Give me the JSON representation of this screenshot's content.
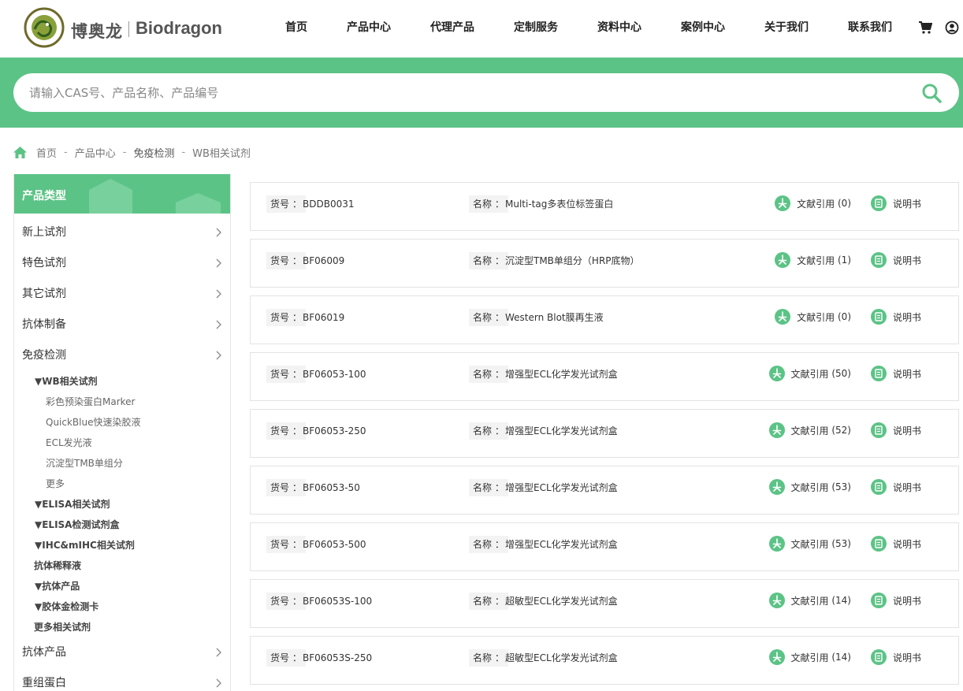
{
  "brand": {
    "name_cn": "博奥龙",
    "name_en": "Biodragon",
    "logo_icon": "biodragon-logo"
  },
  "nav": {
    "items": [
      "首页",
      "产品中心",
      "代理产品",
      "定制服务",
      "资料中心",
      "案例中心",
      "关于我们",
      "联系我们"
    ],
    "cart_icon": "cart-icon",
    "user_icon": "user-icon"
  },
  "search": {
    "placeholder": "请输入CAS号、产品名称、产品编号",
    "value": ""
  },
  "breadcrumb": {
    "items": [
      "首页",
      "产品中心",
      "免疫检测",
      "WB相关试剂"
    ],
    "separator": "-"
  },
  "sidebar": {
    "title": "产品类型",
    "categories_top": [
      "新上试剂",
      "特色试剂",
      "其它试剂",
      "抗体制备",
      "免疫检测"
    ],
    "wb": {
      "title": "WB相关试剂",
      "items": [
        "彩色预染蛋白Marker",
        "QuickBlue快速染胶液",
        "ECL发光液",
        "沉淀型TMB单组分",
        "更多"
      ]
    },
    "subgroups": [
      "ELISA相关试剂",
      "ELISA检测试剂盒",
      "IHC&mIHC相关试剂"
    ],
    "plain1": "抗体稀释液",
    "subgroups2": [
      "抗体产品",
      "胶体金检测卡"
    ],
    "plain2": "更多相关试剂",
    "categories_bottom": [
      "抗体产品",
      "重组蛋白"
    ]
  },
  "product_labels": {
    "code": "货号",
    "name": "名称",
    "colon": "：",
    "cite": "文献引用",
    "manual": "说明书"
  },
  "products": [
    {
      "code": "BDDB0031",
      "name": "Multi-tag多表位标签蛋白",
      "citations": "(0)"
    },
    {
      "code": "BF06009",
      "name": "沉淀型TMB单组分（HRP底物）",
      "citations": "(1)"
    },
    {
      "code": "BF06019",
      "name": "Western Blot膜再生液",
      "citations": "(0)"
    },
    {
      "code": "BF06053-100",
      "name": "增强型ECL化学发光试剂盒",
      "citations": "(50)"
    },
    {
      "code": "BF06053-250",
      "name": "增强型ECL化学发光试剂盒",
      "citations": "(52)"
    },
    {
      "code": "BF06053-50",
      "name": "增强型ECL化学发光试剂盒",
      "citations": "(53)"
    },
    {
      "code": "BF06053-500",
      "name": "增强型ECL化学发光试剂盒",
      "citations": "(53)"
    },
    {
      "code": "BF06053S-100",
      "name": "超敏型ECL化学发光试剂盒",
      "citations": "(14)"
    },
    {
      "code": "BF06053S-250",
      "name": "超敏型ECL化学发光试剂盒",
      "citations": "(14)"
    }
  ],
  "colors": {
    "brand_green": "#5cc386",
    "icon_green": "#5cc386"
  }
}
